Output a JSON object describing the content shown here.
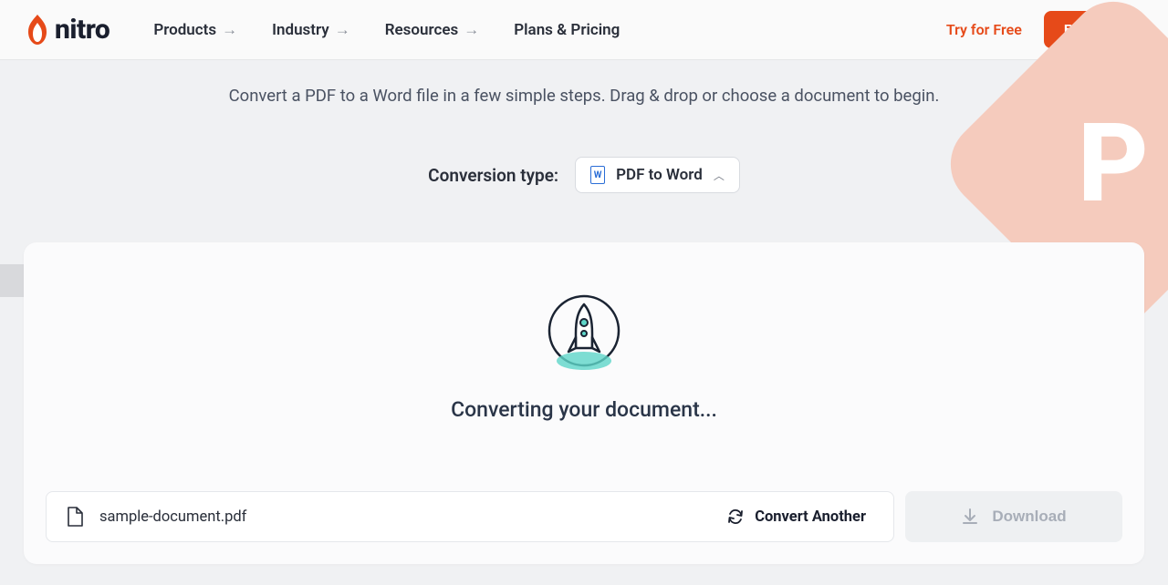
{
  "brand": "nitro",
  "nav": {
    "items": [
      {
        "label": "Products",
        "has_arrow": true
      },
      {
        "label": "Industry",
        "has_arrow": true
      },
      {
        "label": "Resources",
        "has_arrow": true
      },
      {
        "label": "Plans & Pricing",
        "has_arrow": false
      }
    ]
  },
  "header_actions": {
    "try_free": "Try for Free",
    "buy_now": "Buy Now"
  },
  "subtitle": "Convert a PDF to a Word file in a few simple steps. Drag & drop or choose a document to begin.",
  "conversion": {
    "label": "Conversion type:",
    "selected": "PDF to Word",
    "icon": "W"
  },
  "status": "Converting your document...",
  "file": {
    "name": "sample-document.pdf"
  },
  "actions": {
    "convert_another": "Convert Another",
    "download": "Download"
  },
  "colors": {
    "accent": "#e64a19"
  }
}
